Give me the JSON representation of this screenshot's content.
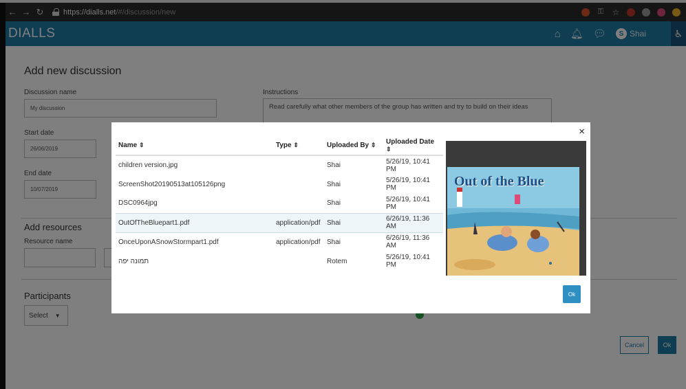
{
  "browser": {
    "url_host": "https://dialls.net",
    "url_path": "/#/discussion/new"
  },
  "header": {
    "logo": "DIALLS",
    "user_initial": "S",
    "user_name": "Shai"
  },
  "form": {
    "title": "Add new discussion",
    "discussion_name_label": "Discussion name",
    "discussion_name_value": "My discussion",
    "instructions_label": "Instructions",
    "instructions_value": "Read carefully what other members of the group has written and try to build on their ideas",
    "start_date_label": "Start date",
    "start_date_value": "26/06/2019",
    "end_date_label": "End date",
    "end_date_value": "10/07/2019",
    "resources_title": "Add resources",
    "resource_name_label": "Resource name",
    "participants_title": "Participants",
    "select_label": "Select",
    "cancel_label": "Cancel",
    "ok_label": "Ok"
  },
  "modal": {
    "close_label": "×",
    "columns": [
      "Name",
      "Type",
      "Uploaded By",
      "Uploaded Date"
    ],
    "sort_glyph": "⇕",
    "rows": [
      {
        "name": "children version.jpg",
        "type": "",
        "uploaded_by": "Shai",
        "date": "5/26/19, 10:41 PM"
      },
      {
        "name": "ScreenShot20190513at105126png",
        "type": "",
        "uploaded_by": "Shai",
        "date": "5/26/19, 10:41 PM"
      },
      {
        "name": "DSC0964jpg",
        "type": "",
        "uploaded_by": "Shai",
        "date": "5/26/19, 10:41 PM"
      },
      {
        "name": "OutOfTheBluepart1.pdf",
        "type": "application/pdf",
        "uploaded_by": "Shai",
        "date": "6/26/19, 11:36 AM"
      },
      {
        "name": "OnceUponASnowStormpart1.pdf",
        "type": "application/pdf",
        "uploaded_by": "Shai",
        "date": "6/26/19, 11:36 AM"
      },
      {
        "name": "תמונה יפה",
        "type": "",
        "uploaded_by": "Rotem",
        "date": "5/26/19, 10:41 PM"
      }
    ],
    "selected_row_index": 3,
    "preview_title": "Out of the Blue",
    "ok_label": "Ok"
  },
  "colors": {
    "brand": "#1f7ca6",
    "header_dark": "#17557a",
    "selected_row": "#eef5f9",
    "modal_ok": "#2e8fc2"
  }
}
